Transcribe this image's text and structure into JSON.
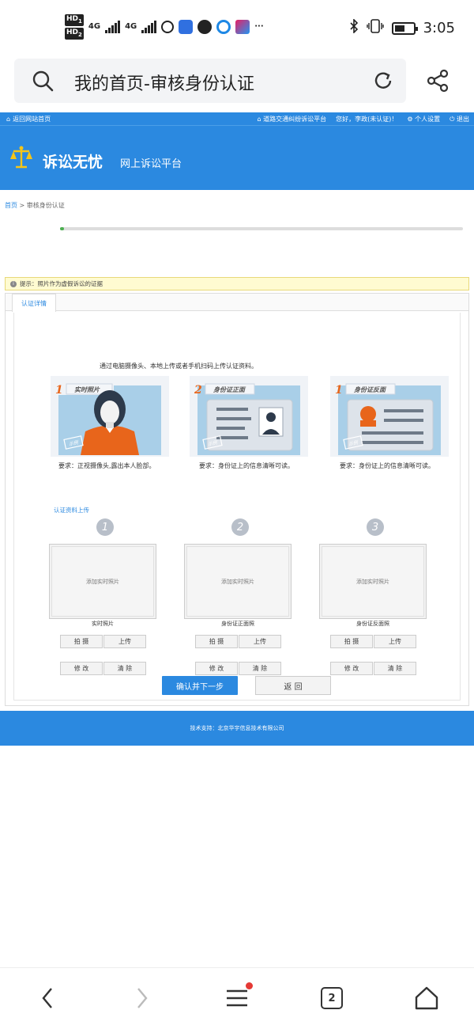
{
  "status_bar": {
    "hd1": "HD",
    "hd1_sub": "1",
    "hd2": "HD",
    "hd2_sub": "2",
    "net1": "4G",
    "net2": "4G",
    "more": "···",
    "time": "3:05"
  },
  "browser": {
    "title": "我的首页-审核身份认证",
    "tab_count": "2"
  },
  "topnav": {
    "back_home": "返回网站首页",
    "platform_link": "道路交通纠纷诉讼平台",
    "greeting": "您好，李政(未认证)！",
    "settings": "个人设置",
    "logout": "退出"
  },
  "banner": {
    "title": "诉讼无忧",
    "subtitle": "网上诉讼平台"
  },
  "breadcrumb": {
    "home": "首页",
    "sep": " > ",
    "current": "审核身份认证"
  },
  "progress": {
    "fraction": 0.01
  },
  "notice": {
    "icon": "i",
    "text": "提示：照片作为虚假诉讼的证据"
  },
  "tab": {
    "label": "认证详情"
  },
  "instruction": "通过电脑摄像头、本地上传或者手机扫码上传认证资料。",
  "samples": [
    {
      "num": "1",
      "label": "实时照片",
      "stamp": "示例",
      "requirement": "要求：正视摄像头,露出本人脸部。"
    },
    {
      "num": "2",
      "label": "身份证正面",
      "stamp": "示例",
      "requirement": "要求：身份证上的信息清晰可读。"
    },
    {
      "num": "1",
      "label": "身份证反面",
      "stamp": "示例",
      "requirement": "要求：身份证上的信息清晰可读。"
    }
  ],
  "upload_section_label": "认证资料上传",
  "uploads": [
    {
      "step": "1",
      "placeholder": "添加实时照片",
      "caption": "实时照片",
      "btn_capture": "拍 摄",
      "btn_upload": "上传",
      "btn_edit": "修 改",
      "btn_clear": "清 除"
    },
    {
      "step": "2",
      "placeholder": "添加实时照片",
      "caption": "身份证正面照",
      "btn_capture": "拍 摄",
      "btn_upload": "上传",
      "btn_edit": "修 改",
      "btn_clear": "清 除"
    },
    {
      "step": "3",
      "placeholder": "添加实时照片",
      "caption": "身份证反面照",
      "btn_capture": "拍 摄",
      "btn_upload": "上传",
      "btn_edit": "修 改",
      "btn_clear": "清 除"
    }
  ],
  "actions": {
    "confirm": "确认并下一步",
    "back": "返 回"
  },
  "footer": "技术支持：北京华宇信息技术有限公司",
  "colors": {
    "brand_blue": "#2b89e0",
    "progress_green": "#4caf50",
    "notice_bg": "#fffbd1",
    "orange": "#e8651b"
  }
}
